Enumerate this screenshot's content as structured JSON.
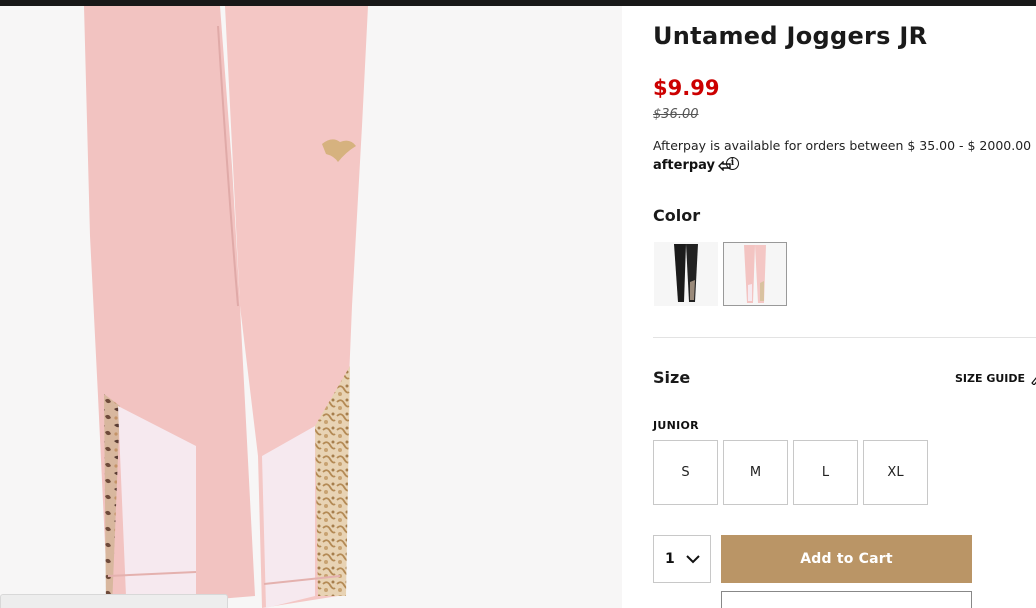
{
  "product": {
    "title": "Untamed Joggers JR",
    "sale_price": "$9.99",
    "original_price": "$36.00"
  },
  "afterpay": {
    "message": "Afterpay is available for orders between $ 35.00 - $ 2000.00",
    "logo_text": "afterpay",
    "info_glyph": "i"
  },
  "color": {
    "label": "Color",
    "swatches": [
      {
        "name": "black",
        "hex": "#1b1b1b"
      },
      {
        "name": "pink",
        "hex": "#f3c4c2",
        "selected": true
      }
    ]
  },
  "size": {
    "label": "Size",
    "guide_label": "SIZE GUIDE",
    "group_label": "JUNIOR",
    "options": [
      "S",
      "M",
      "L",
      "XL"
    ]
  },
  "cart": {
    "quantity": "1",
    "add_label": "Add to Cart"
  },
  "colors": {
    "sale": "#cc0000",
    "add_to_cart": "#ba9566",
    "product_pink": "#f3c4c2"
  },
  "icons": [
    "afterpay-arrows-icon",
    "info-icon",
    "ruler-icon",
    "chevron-down-icon"
  ]
}
